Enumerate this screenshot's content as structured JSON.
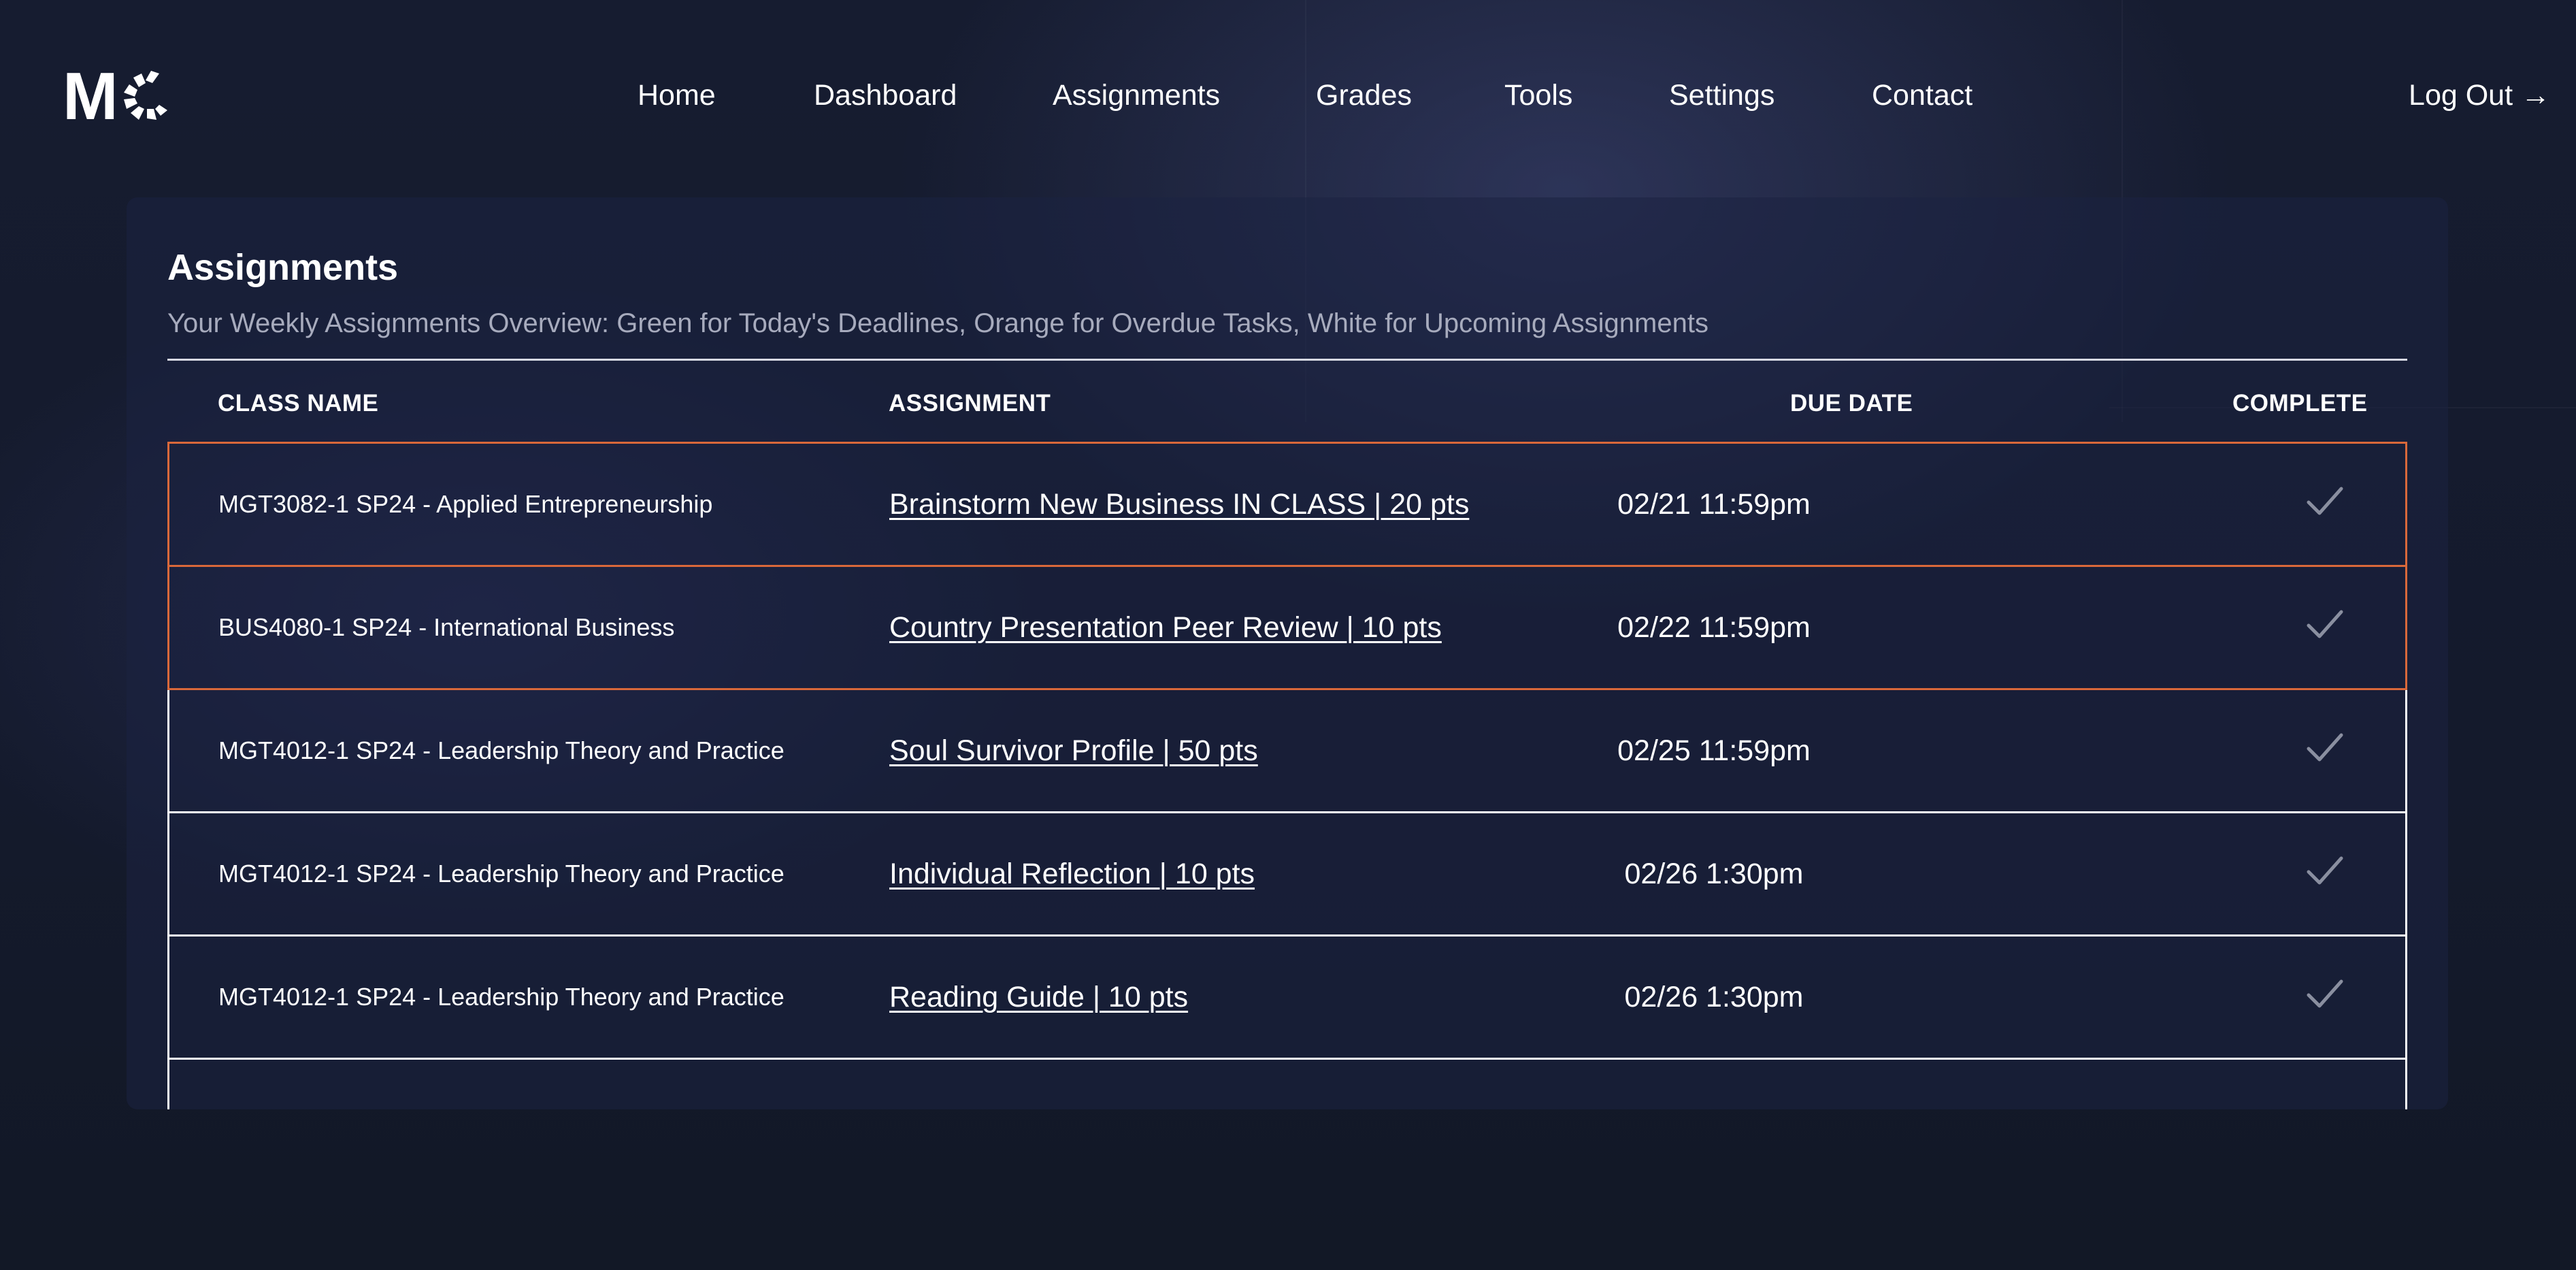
{
  "nav": {
    "items": [
      "Home",
      "Dashboard",
      "Assignments",
      "Grades",
      "Tools",
      "Settings",
      "Contact"
    ],
    "logout_label": "Log Out →"
  },
  "logo": {
    "letter": "M"
  },
  "assignments": {
    "title": "Assignments",
    "subtitle": "Your Weekly Assignments Overview: Green for Today's Deadlines, Orange for Overdue Tasks, White for Upcoming Assignments",
    "columns": {
      "class_name": "CLASS NAME",
      "assignment": "ASSIGNMENT",
      "due_date": "DUE DATE",
      "complete": "COMPLETE"
    },
    "rows": [
      {
        "class_name": "MGT3082-1 SP24 - Applied Entrepreneurship",
        "assignment": "Brainstorm New Business IN CLASS | 20 pts",
        "due_date": "02/21 11:59pm",
        "status": "overdue"
      },
      {
        "class_name": "BUS4080-1 SP24 - International Business",
        "assignment": "Country Presentation Peer Review | 10 pts",
        "due_date": "02/22 11:59pm",
        "status": "overdue"
      },
      {
        "class_name": "MGT4012-1 SP24 - Leadership Theory and Practice",
        "assignment": "Soul Survivor Profile | 50 pts",
        "due_date": "02/25 11:59pm",
        "status": "upcoming"
      },
      {
        "class_name": "MGT4012-1 SP24 - Leadership Theory and Practice",
        "assignment": "Individual Reflection | 10 pts",
        "due_date": "02/26 1:30pm",
        "status": "upcoming"
      },
      {
        "class_name": "MGT4012-1 SP24 - Leadership Theory and Practice",
        "assignment": "Reading Guide | 10 pts",
        "due_date": "02/26 1:30pm",
        "status": "upcoming"
      }
    ]
  },
  "colors": {
    "background": "#141a2b",
    "card": "#1c2242",
    "overdue_border": "#d9683a",
    "today_border": "#46c46e",
    "upcoming_border": "#ffffff",
    "subtitle_text": "#a7abbd",
    "check_icon": "#8a8fa0"
  },
  "icons": {
    "complete": "check-icon",
    "logout_arrow": "right-arrow"
  }
}
